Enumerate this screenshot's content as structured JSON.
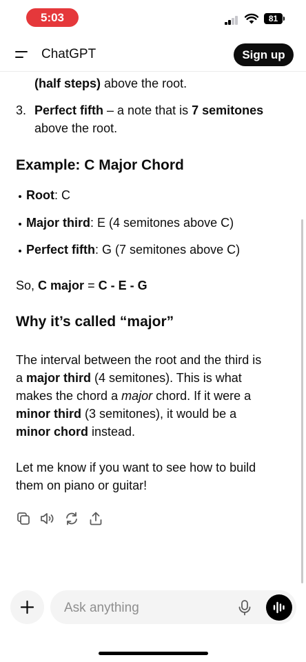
{
  "status_bar": {
    "time": "5:03",
    "battery": "81"
  },
  "header": {
    "title": "ChatGPT",
    "signup_label": "Sign up"
  },
  "message": {
    "list_continuation": {
      "bold": "(half steps)",
      "text": " above the root."
    },
    "list_item_3": {
      "number": "3.",
      "bold1": "Perfect fifth",
      "text1": " – a note that is ",
      "bold2": "7 semitones",
      "line2": "above the root."
    },
    "example_heading": "Example: C Major Chord",
    "bullets": [
      {
        "bold": "Root",
        "text": ": C"
      },
      {
        "bold": "Major third",
        "text": ": E (4 semitones above C)"
      },
      {
        "bold": "Perfect fifth",
        "text": ": G (7 semitones above C)"
      }
    ],
    "so_line": {
      "prefix": "So, ",
      "bold": "C major",
      "mid": " = ",
      "bold2": "C - E - G"
    },
    "why_heading": "Why it’s called “major”",
    "para1": {
      "line1": "The interval between the root and the third is",
      "line2_prefix": "a ",
      "line2_bold": "major third",
      "line2_text": " (4 semitones). This is what",
      "line3_prefix": "makes the chord a ",
      "line3_italic": "major",
      "line3_text": " chord. If it were a",
      "line4_bold": "minor third",
      "line4_text": " (3 semitones), it would be a",
      "line5_bold": "minor chord",
      "line5_text": " instead."
    },
    "para2": {
      "line1": "Let me know if you want to see how to build",
      "line2": "them on piano or guitar!"
    }
  },
  "actions": [
    "copy-icon",
    "read-aloud-icon",
    "regenerate-icon",
    "share-icon"
  ],
  "composer": {
    "placeholder": "Ask anything"
  }
}
